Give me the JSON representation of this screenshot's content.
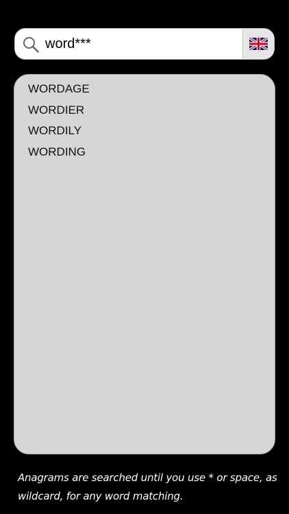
{
  "search": {
    "value": "word***",
    "icon": "search-icon"
  },
  "language_button": {
    "icon": "uk-flag-icon",
    "flag_colors": {
      "blue": "#012169",
      "red": "#C8102E",
      "white": "#FFFFFF"
    }
  },
  "results": {
    "items": [
      "WORDAGE",
      "WORDIER",
      "WORDILY",
      "WORDING"
    ]
  },
  "hint": {
    "text": "Anagrams are searched until you use * or space, as wildcard, for any word matching."
  },
  "colors": {
    "background": "#000000",
    "panel": "#d6d6d6",
    "search_field": "#ffffff"
  }
}
